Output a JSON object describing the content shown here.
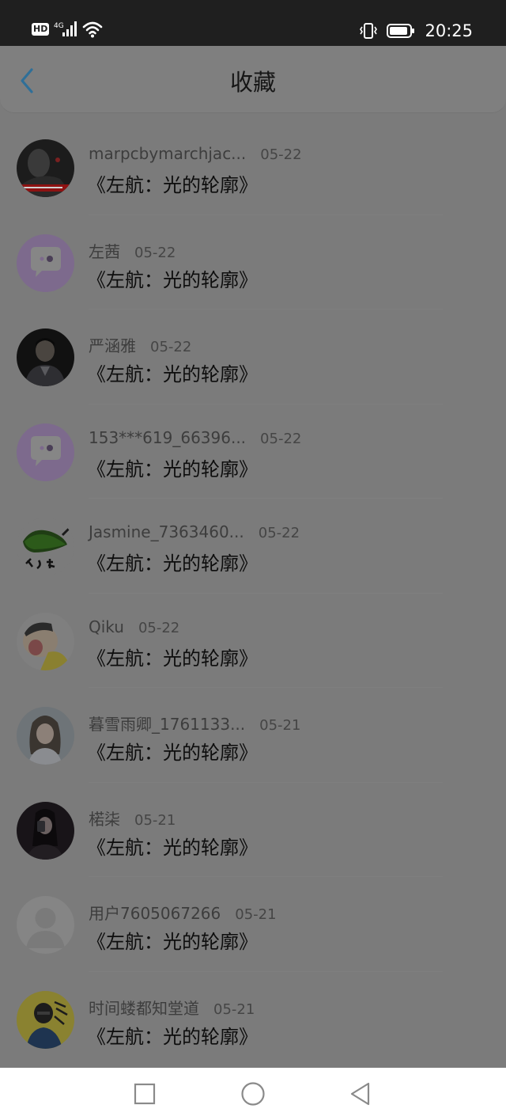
{
  "status_bar": {
    "hd_badge": "HD",
    "signal_label": "4G",
    "time": "20:25",
    "icons": [
      "hd-icon",
      "signal-icon",
      "wifi-icon",
      "vibrate-icon",
      "battery-icon"
    ]
  },
  "header": {
    "title": "收藏",
    "back_icon": "chevron-left-icon",
    "accent_color": "#2f6f98"
  },
  "favorites": [
    {
      "username": "marpcbymarchjac...",
      "date": "05-22",
      "title": "《左航：光的轮廓》"
    },
    {
      "username": "左茜",
      "date": "05-22",
      "title": "《左航：光的轮廓》"
    },
    {
      "username": "严涵雅",
      "date": "05-22",
      "title": "《左航：光的轮廓》"
    },
    {
      "username": "153***619_66396...",
      "date": "05-22",
      "title": "《左航：光的轮廓》"
    },
    {
      "username": "Jasmine_7363460...",
      "date": "05-22",
      "title": "《左航：光的轮廓》"
    },
    {
      "username": "Qiku",
      "date": "05-22",
      "title": "《左航：光的轮廓》"
    },
    {
      "username": "暮雪雨卿_1761133...",
      "date": "05-21",
      "title": "《左航：光的轮廓》"
    },
    {
      "username": "楉柒",
      "date": "05-21",
      "title": "《左航：光的轮廓》"
    },
    {
      "username": "用户7605067266",
      "date": "05-21",
      "title": "《左航：光的轮廓》"
    },
    {
      "username": "时间蝼都知堂道",
      "date": "05-21",
      "title": "《左航：光的轮廓》"
    }
  ],
  "nav_bar": {
    "icons": [
      "recents-square-icon",
      "home-circle-icon",
      "back-triangle-icon"
    ]
  }
}
